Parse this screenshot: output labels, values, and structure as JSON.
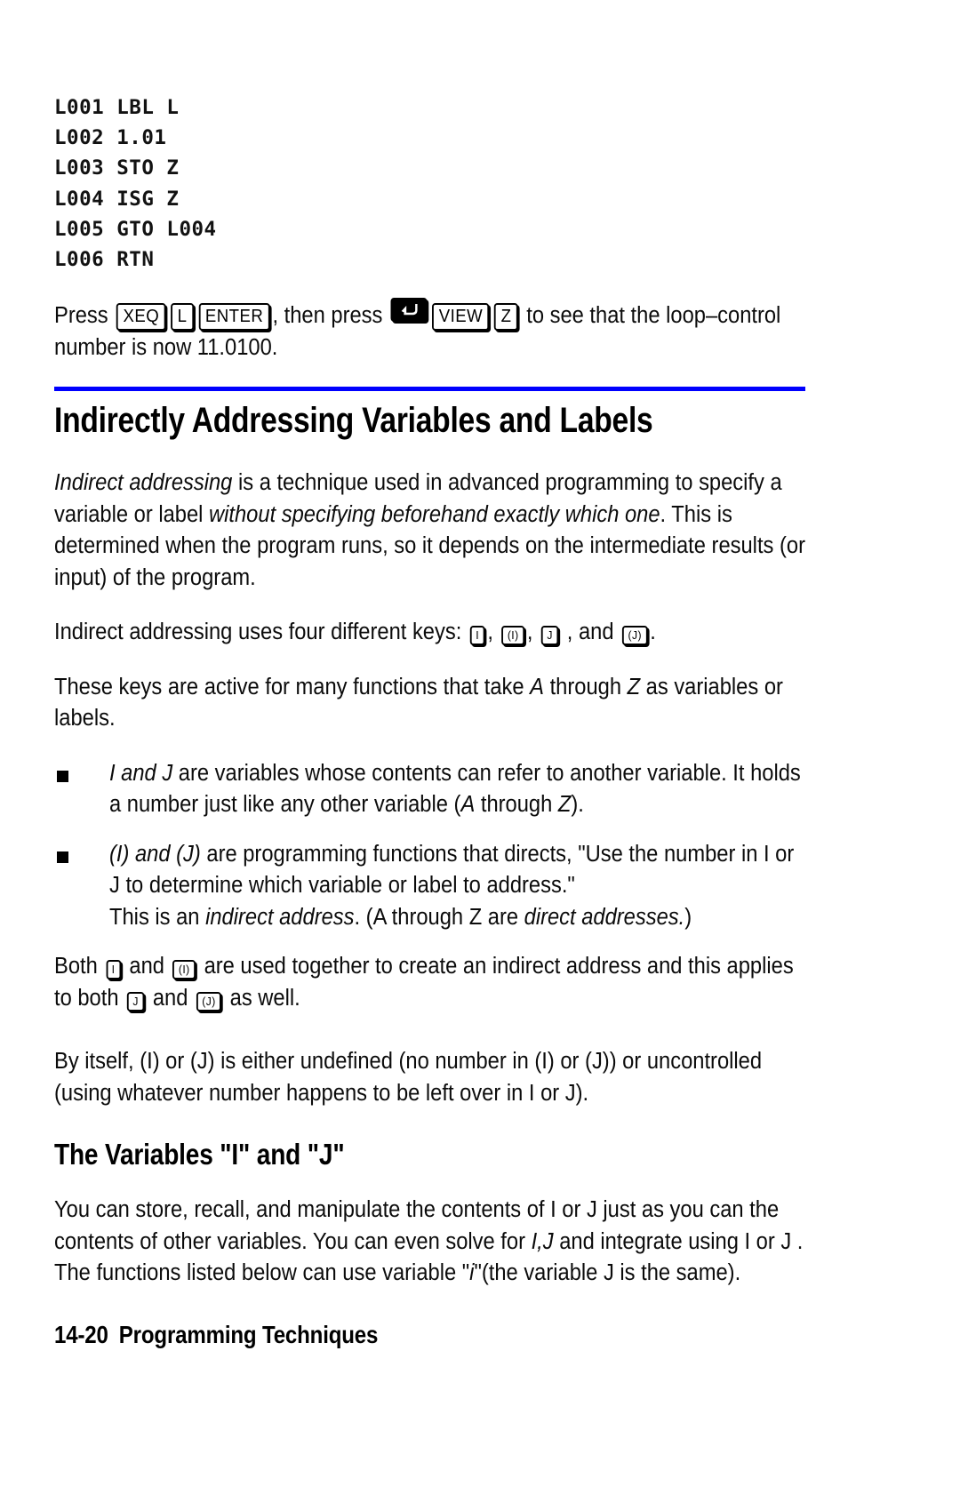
{
  "page": {
    "number": "14-20",
    "footer_title": "Programming Techniques"
  },
  "program_listing": {
    "lines": [
      "L001 LBL L",
      "L002 1.01",
      "L003 STO Z",
      "L004 ISG Z",
      "L005 GTO L004",
      "L006 RTN"
    ]
  },
  "press_instruction": {
    "part1": "Press ",
    "key_xeq": "XEQ",
    "key_l": "L",
    "key_enter": "ENTER",
    "part2": ", then press ",
    "key_shift": "shift-left-arrow",
    "key_view": "VIEW",
    "key_z": "Z",
    "part3": " to see that the loop–control number is now 11.0100."
  },
  "section": {
    "title": "Indirectly Addressing Variables and Labels",
    "rule_color": "#0000ff"
  },
  "paragraphs": {
    "intro_a": "Indirect addressing",
    "intro_b": " is a technique used in advanced programming to specify a variable or label ",
    "intro_c": "without specifying beforehand exactly which one",
    "intro_d": ". This is determined when the program runs, so it depends on the intermediate results (or input) of the program.",
    "four_keys_lead": "Indirect addressing uses four different keys: ",
    "four_keys_comma1": ", ",
    "four_keys_comma2": ", ",
    "four_keys_and": " , and ",
    "four_keys_end": ".",
    "active_keys_a": "These keys are active for many functions that take ",
    "active_keys_b": "A",
    "active_keys_c": " through ",
    "active_keys_d": "Z",
    "active_keys_e": " as variables or labels.",
    "both_a": "Both ",
    "both_b": " and ",
    "both_c": " are used together to create an indirect address and this applies to both ",
    "both_d": " and ",
    "both_e": " as well.",
    "by_itself": "By itself, (I) or (J) is either undefined (no number in (I) or (J)) or uncontrolled (using whatever number happens to be left over in I or J)."
  },
  "bullets": [
    {
      "italic_lead": "I and J ",
      "text": "are variables whose contents can refer to another variable. It holds a number just like any other variable (",
      "italic_a": "A",
      "mid": " through ",
      "italic_b": "Z",
      "tail": ")."
    },
    {
      "italic_lead": "(I) and (J) ",
      "text": "are programming functions that directs, \"Use the number in I or J to determine which variable or label to address.\"",
      "line2_a": "This is an ",
      "line2_italic_a": "indirect address",
      "line2_b": ". (A through Z are ",
      "line2_italic_b": "direct addresses.",
      "line2_c": ")"
    }
  ],
  "subsection": {
    "title": "The Variables \"I\" and \"J\"",
    "body_a": "You can store, recall, and manipulate the contents of I or J just as you can the contents of other variables. You can even solve for ",
    "body_italic_a": "I,J",
    "body_b": " and integrate using I or J . The functions listed below can use variable \"",
    "body_italic_b": "i",
    "body_c": "\"(the variable J is the same)."
  },
  "keys": {
    "i": "I",
    "i_paren": "(I)",
    "j": "J",
    "j_paren": "(J)"
  }
}
